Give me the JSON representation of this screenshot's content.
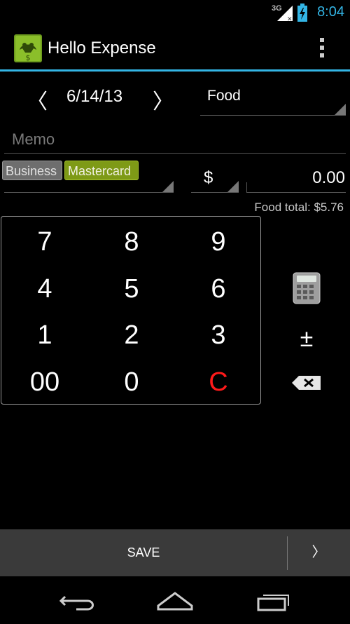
{
  "status_bar": {
    "time": "8:04",
    "network": "3G"
  },
  "app": {
    "title": "Hello Expense",
    "icons": {
      "logo": "frog-icon",
      "overflow": "overflow-menu-icon"
    }
  },
  "entry": {
    "prev_arrow": "〈",
    "date": "6/14/13",
    "next_arrow": "〉",
    "category": "Food",
    "memo_placeholder": "Memo",
    "tags": [
      "Business",
      "Mastercard"
    ],
    "currency": "$",
    "amount": "0.00",
    "category_total": "Food total: $5.76"
  },
  "keypad": {
    "rows": [
      [
        "7",
        "8",
        "9"
      ],
      [
        "4",
        "5",
        "6"
      ],
      [
        "1",
        "2",
        "3"
      ],
      [
        "00",
        "0",
        "C"
      ]
    ],
    "plus_minus": "±"
  },
  "bottom": {
    "save_label": "SAVE",
    "next_label": "〉"
  },
  "colors": {
    "accent": "#33b5e5",
    "tag_business": "#6e6e6e",
    "tag_mastercard": "#7e9a16",
    "clear_key": "#ff1a1a",
    "bottom_bar": "#3a3a3a"
  }
}
